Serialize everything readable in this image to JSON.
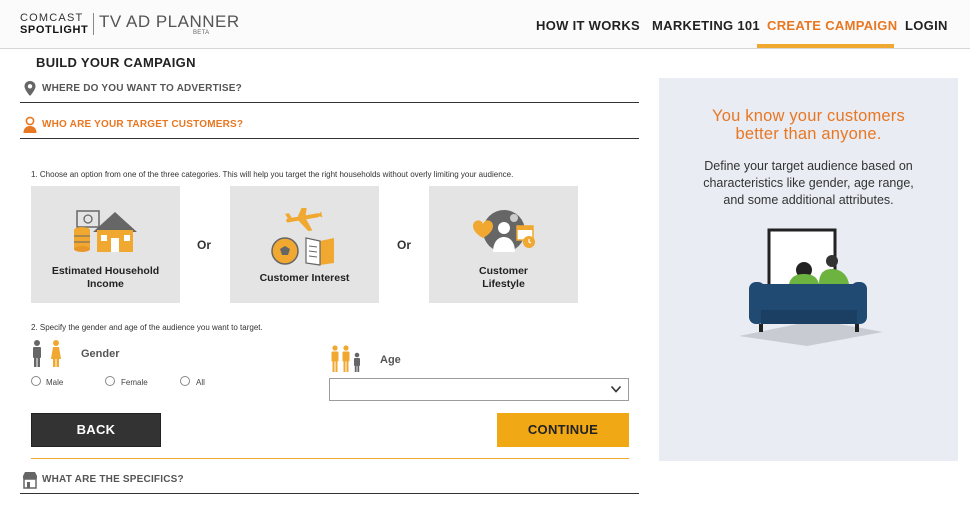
{
  "header": {
    "logo_line1": "COMCAST",
    "logo_line2": "SPOTLIGHT",
    "app_name": "TV AD PLANNER",
    "beta": "BETA",
    "nav": [
      {
        "label": "HOW IT WORKS"
      },
      {
        "label": "MARKETING 101"
      },
      {
        "label": "CREATE CAMPAIGN",
        "active": true
      },
      {
        "label": "LOGIN"
      }
    ]
  },
  "main": {
    "title": "BUILD YOUR CAMPAIGN",
    "sections": {
      "where": {
        "label": "WHERE DO YOU WANT TO ADVERTISE?",
        "icon": "map-pin-icon"
      },
      "who": {
        "label": "WHO ARE YOUR TARGET CUSTOMERS?",
        "icon": "person-icon"
      },
      "specifics": {
        "label": "WHAT ARE THE SPECIFICS?",
        "icon": "store-icon"
      }
    },
    "step1": "1. Choose an option from one of the three categories. This will help you target the right households without overly limiting your audience.",
    "options": [
      {
        "label_line1": "Estimated Household",
        "label_line2": "Income",
        "icon": "house-money-icon"
      },
      {
        "label_line1": "Customer Interest",
        "label_line2": "",
        "icon": "interests-icon"
      },
      {
        "label_line1": "Customer",
        "label_line2": "Lifestyle",
        "icon": "lifestyle-icon"
      }
    ],
    "or_label": "Or",
    "step2": "2. Specify the gender and age of the audience you want to target.",
    "gender_label": "Gender",
    "gender_options": [
      "Male",
      "Female",
      "All"
    ],
    "age_label": "Age",
    "age_select_value": "",
    "back_label": "BACK",
    "continue_label": "CONTINUE"
  },
  "side_panel": {
    "headline_line1": "You know your customers",
    "headline_line2": "better than anyone.",
    "body_line1": "Define your target audience based on",
    "body_line2": "characteristics like gender, age range,",
    "body_line3": "and some additional attributes."
  },
  "colors": {
    "accent_orange": "#e87722",
    "button_yellow": "#f0a815",
    "button_dark": "#333333",
    "card_gray": "#e4e4e4",
    "panel_blue_gray": "#eaecf4"
  }
}
